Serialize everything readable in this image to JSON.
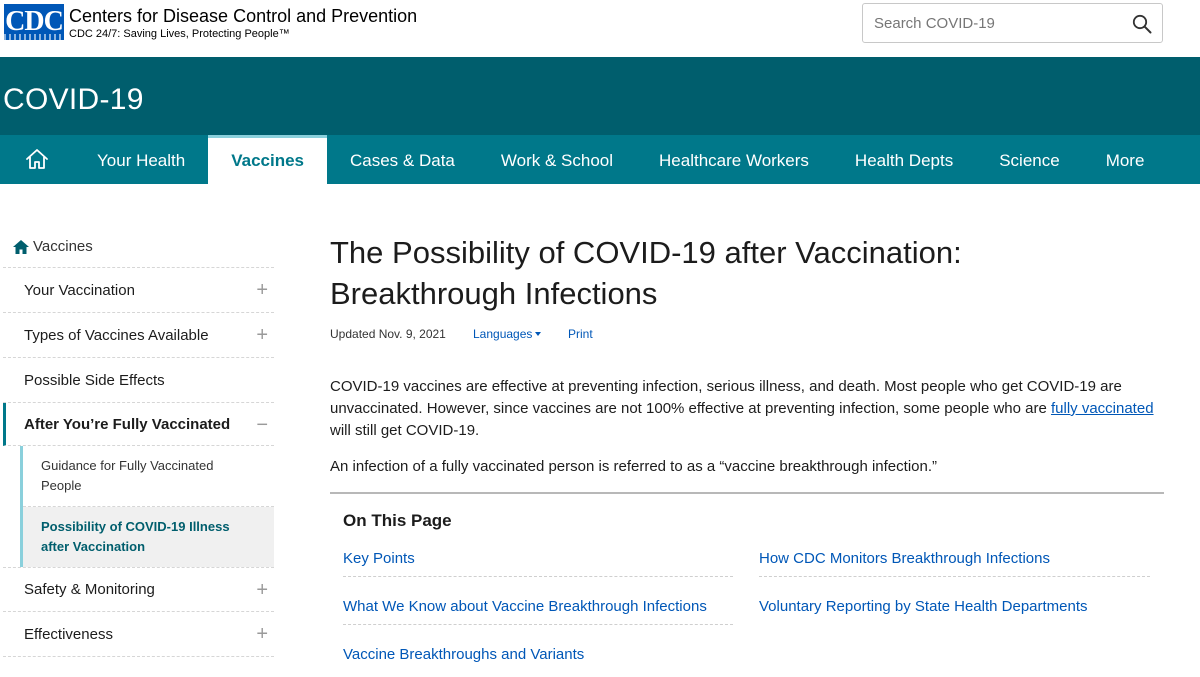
{
  "header": {
    "logo_text": "CDC",
    "org_name": "Centers for Disease Control and Prevention",
    "tagline": "CDC 24/7: Saving Lives, Protecting People™",
    "search_placeholder": "Search COVID-19",
    "search_icon": "search-icon"
  },
  "site": {
    "title": "COVID-19"
  },
  "nav": {
    "home_icon": "home-icon",
    "items": [
      {
        "label": "Your Health"
      },
      {
        "label": "Vaccines",
        "active": true
      },
      {
        "label": "Cases & Data"
      },
      {
        "label": "Work & School"
      },
      {
        "label": "Healthcare Workers"
      },
      {
        "label": "Health Depts"
      },
      {
        "label": "Science"
      },
      {
        "label": "More"
      }
    ]
  },
  "sidebar": {
    "home_label": "Vaccines",
    "items": [
      {
        "label": "Your Vaccination",
        "toggle": "+"
      },
      {
        "label": "Types of Vaccines Available",
        "toggle": "+"
      },
      {
        "label": "Possible Side Effects",
        "toggle": ""
      },
      {
        "label": "After You’re Fully Vaccinated",
        "toggle": "−"
      }
    ],
    "sub_items": [
      {
        "label": "Guidance for Fully Vaccinated People"
      },
      {
        "label": "Possibility of COVID-19 Illness after Vaccination"
      }
    ],
    "after_items": [
      {
        "label": "Safety & Monitoring",
        "toggle": "+"
      },
      {
        "label": "Effectiveness",
        "toggle": "+"
      }
    ]
  },
  "main": {
    "title_line1": "The Possibility of COVID-19 after Vaccination:",
    "title_line2": "Breakthrough Infections",
    "updated": "Updated Nov. 9, 2021",
    "languages": "Languages",
    "print": "Print",
    "p1_before": "COVID-19 vaccines are effective at preventing infection, serious illness, and death. Most people who get COVID-19 are unvaccinated. However, since vaccines are not 100% effective at preventing infection, some people who are ",
    "p1_link": "fully vaccinated",
    "p1_after": " will still get COVID-19.",
    "p2": "An infection of a fully vaccinated person is referred to as a “vaccine breakthrough infection.”",
    "on_this_page": {
      "title": "On This Page",
      "links": [
        "Key Points",
        "How CDC Monitors Breakthrough Infections",
        "What We Know about Vaccine Breakthrough Infections",
        "Voluntary Reporting by State Health Departments",
        "Vaccine Breakthroughs and Variants"
      ]
    }
  },
  "colors": {
    "band": "#005e6d",
    "nav": "#00788a",
    "link": "#0057b7",
    "logo": "#0057b7"
  }
}
